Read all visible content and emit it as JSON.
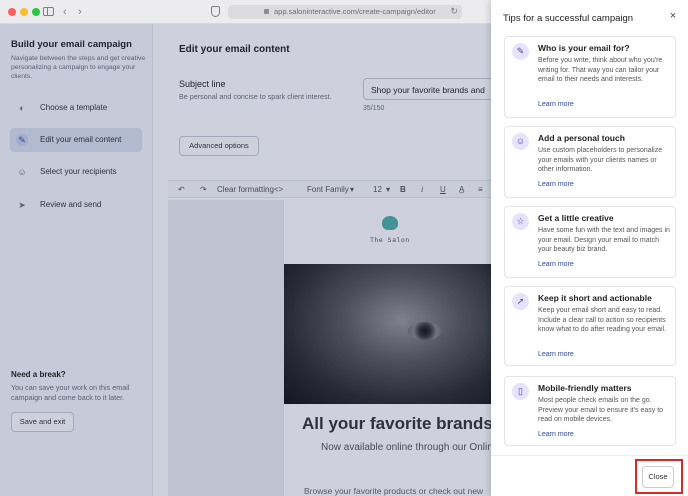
{
  "browser": {
    "url": "app.saloninteractive.com/create-campaign/editor",
    "buttons": {
      "back": "‹",
      "forward": "›",
      "reload": "↻"
    }
  },
  "sidebar": {
    "title": "Build your email campaign",
    "description": "Navigate between the steps and get creative personalizing a campaign to engage your clients.",
    "steps": [
      {
        "label": "Choose a template",
        "icon": "palette-icon",
        "active": false
      },
      {
        "label": "Edit your email content",
        "icon": "pencil-icon",
        "active": true
      },
      {
        "label": "Select your recipients",
        "icon": "users-icon",
        "active": false
      },
      {
        "label": "Review and send",
        "icon": "send-icon",
        "active": false
      }
    ],
    "break_title": "Need a break?",
    "break_desc": "You can save your work on this email campaign and come back to it later.",
    "save_exit_label": "Save and exit"
  },
  "editor": {
    "title": "Edit your email content",
    "subject_label": "Subject line",
    "subject_help": "Be personal and concise to spark client interest.",
    "subject_value": "Shop your favorite brands and",
    "subject_count": "35/150",
    "advanced_label": "Advanced options",
    "toolbar": {
      "undo": "↶",
      "redo": "↷",
      "clear_formatting": "Clear formatting",
      "code": "<>",
      "font_family": "Font Family",
      "font_size": "12",
      "bold": "B",
      "italic": "i",
      "underline": "U",
      "align": "≡"
    },
    "email": {
      "logo_text": "The Salon",
      "headline": "All your favorite brands &",
      "subheadline": "Now available online through our Online",
      "body": "Browse your favorite products or check out new"
    }
  },
  "tips": {
    "title": "Tips for a successful campaign",
    "close_x": "×",
    "items": [
      {
        "icon": "pencil-icon",
        "glyph": "✎",
        "title": "Who is your email for?",
        "desc": "Before you write, think about who you're writing for. That way you can tailor your email to their needs and interests.",
        "link": "Learn more"
      },
      {
        "icon": "smile-icon",
        "glyph": "☺",
        "title": "Add a personal touch",
        "desc": "Use custom placeholders to personalize your emails with your clients names or other information.",
        "link": "Learn more"
      },
      {
        "icon": "star-icon",
        "glyph": "☆",
        "title": "Get a little creative",
        "desc": "Have some fun with the text and images in your email. Design your email to match your beauty biz brand.",
        "link": "Learn more"
      },
      {
        "icon": "cursor-click-icon",
        "glyph": "➚",
        "title": "Keep it short and actionable",
        "desc": "Keep your email short and easy to read. Include a clear call to action so recipients know what to do after reading your email.",
        "link": "Learn more"
      },
      {
        "icon": "mobile-icon",
        "glyph": "▯",
        "title": "Mobile-friendly matters",
        "desc": "Most people check emails on the go. Preview your email to ensure it's easy to read on mobile devices.",
        "link": "Learn more"
      }
    ],
    "close_label": "Close"
  },
  "colors": {
    "accent": "#4f46b5",
    "link": "#2b4aa0",
    "highlight": "#d62b2b"
  }
}
